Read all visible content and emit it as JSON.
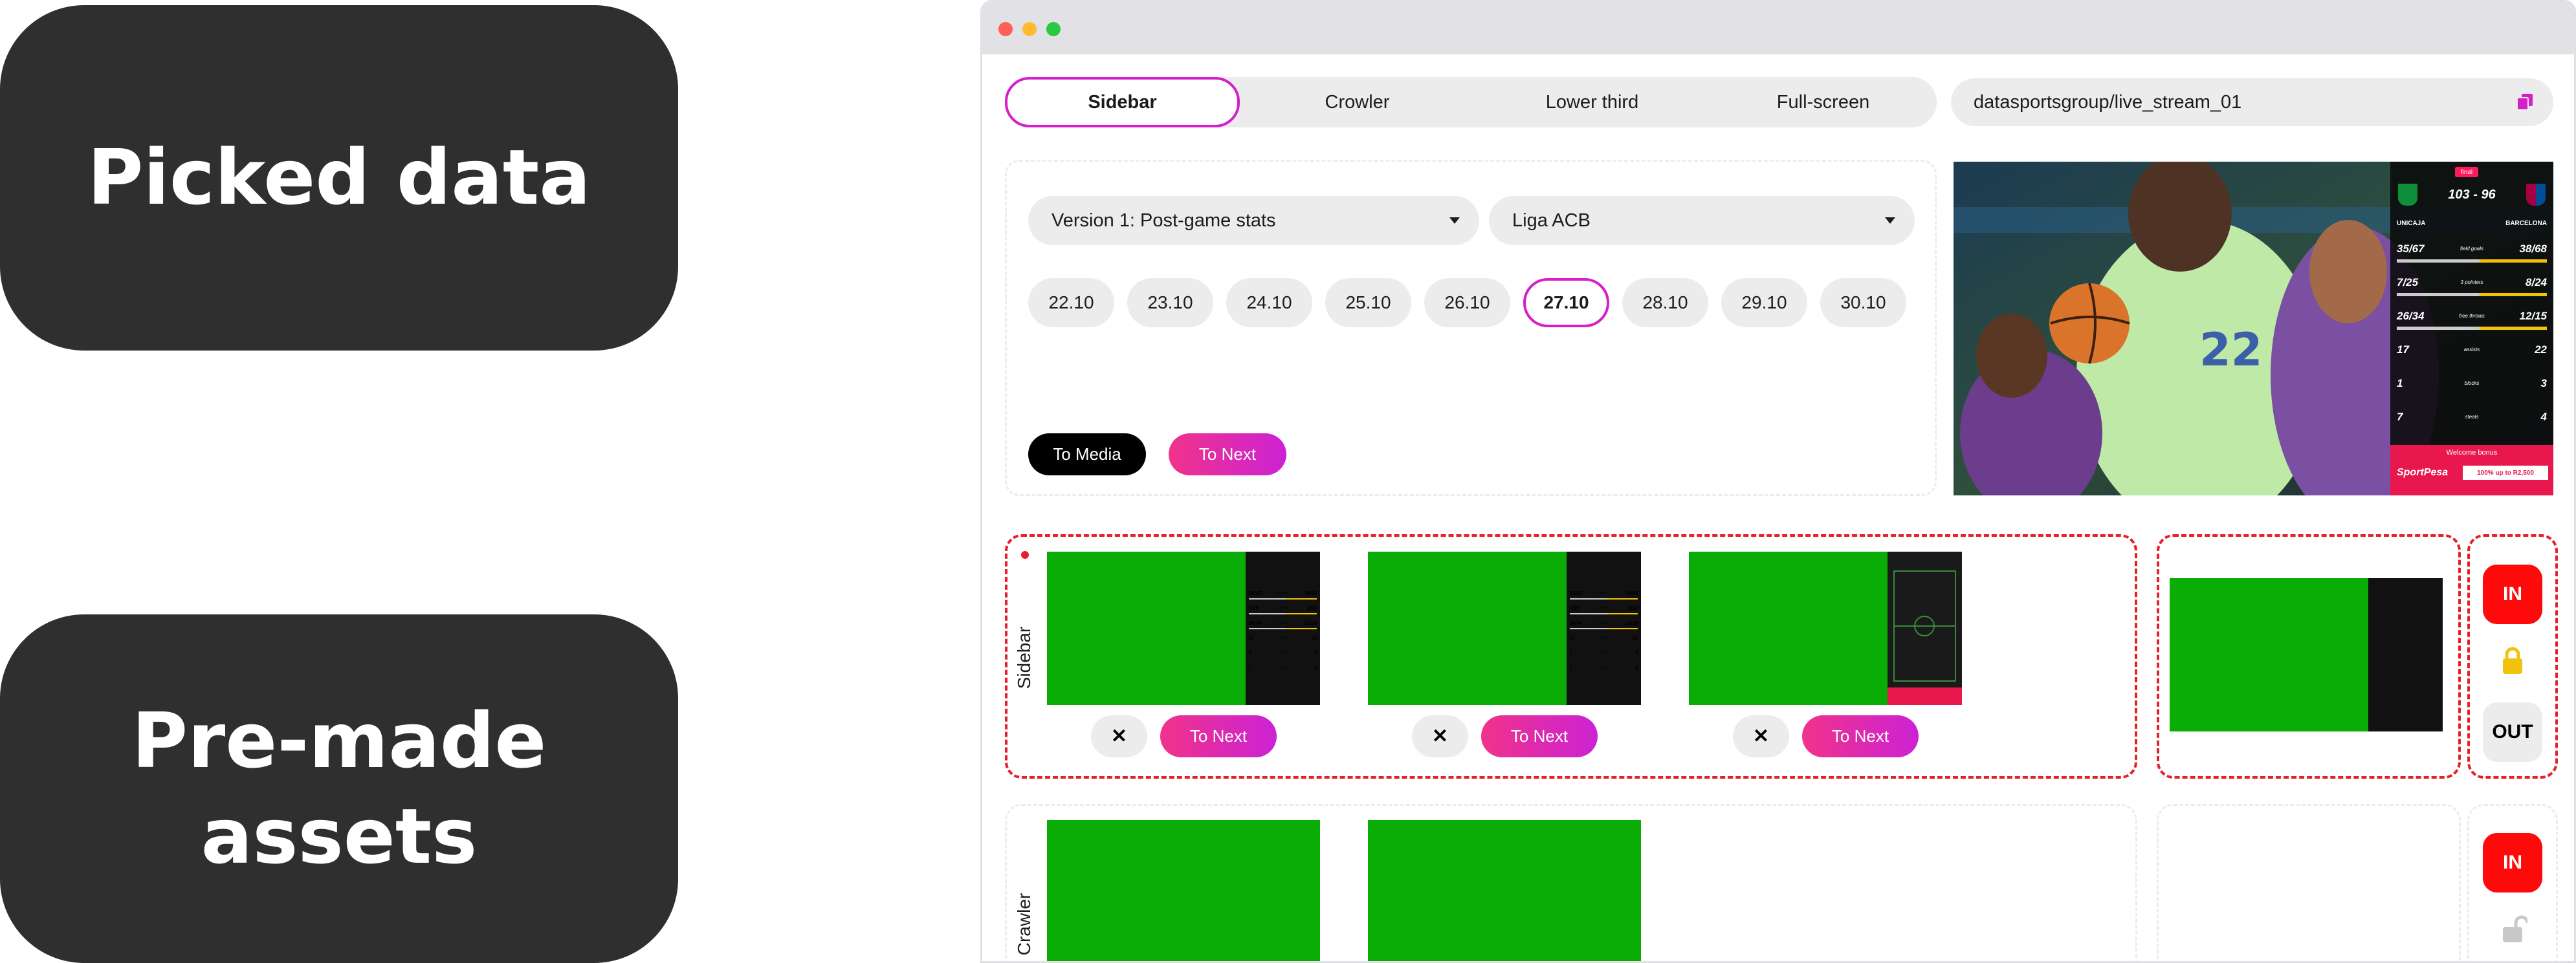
{
  "labels": {
    "picked_data": "Picked data",
    "premade_line1": "Pre-made",
    "premade_line2": "assets"
  },
  "tabs": [
    "Sidebar",
    "Crowler",
    "Lower third",
    "Full-screen"
  ],
  "active_tab": "Sidebar",
  "stream": {
    "value": "datasportsgroup/live_stream_01"
  },
  "selects": {
    "version": "Version 1: Post-game stats",
    "league": "Liga ACB"
  },
  "dates": [
    "22.10",
    "23.10",
    "24.10",
    "25.10",
    "26.10",
    "27.10",
    "28.10",
    "29.10",
    "30.10"
  ],
  "active_date": "27.10",
  "buttons": {
    "to_media": "To Media",
    "to_next": "To Next",
    "close": "✕",
    "in": "IN",
    "out": "OUT"
  },
  "rows": {
    "sidebar": "Sidebar",
    "crawler": "Crawler"
  },
  "scoreboard": {
    "status": "final",
    "score": "103 - 96",
    "home": "UNICAJA",
    "away": "BARCELONA",
    "stats": [
      {
        "home": "35/67",
        "label": "field goals",
        "away": "38/68"
      },
      {
        "home": "7/25",
        "label": "3 pointers",
        "away": "8/24"
      },
      {
        "home": "26/34",
        "label": "free throws",
        "away": "12/15"
      },
      {
        "home": "17",
        "label": "assists",
        "away": "22"
      },
      {
        "home": "1",
        "label": "blocks",
        "away": "3"
      },
      {
        "home": "7",
        "label": "steals",
        "away": "4"
      }
    ],
    "sponsor_top": "Welcome bonus",
    "sponsor_brand": "SportPesa",
    "sponsor_offer": "100% up to R2,500"
  },
  "colors": {
    "accent": "#d61ec9",
    "chroma_green": "#0aad06",
    "danger": "#ff0a0a",
    "lock": "#f1c20b"
  }
}
